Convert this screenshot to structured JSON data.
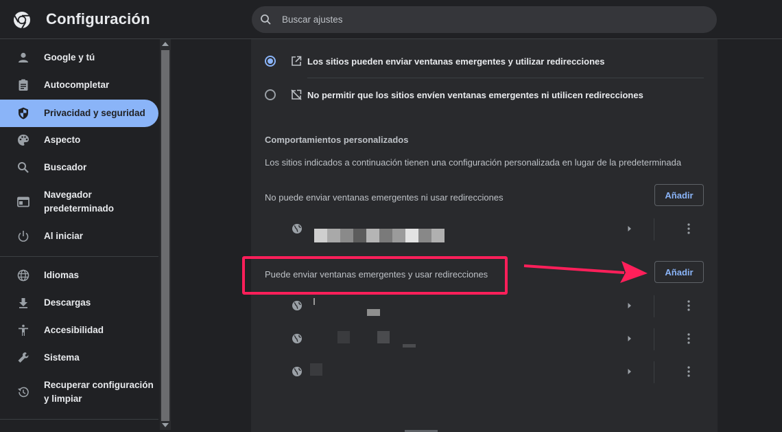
{
  "header": {
    "title": "Configuración",
    "search_placeholder": "Buscar ajustes"
  },
  "sidebar": {
    "items": [
      {
        "label": "Google y tú",
        "icon": "person-icon"
      },
      {
        "label": "Autocompletar",
        "icon": "clipboard-icon"
      },
      {
        "label": "Privacidad y seguridad",
        "icon": "shield-icon",
        "active": true
      },
      {
        "label": "Aspecto",
        "icon": "palette-icon"
      },
      {
        "label": "Buscador",
        "icon": "search-icon"
      },
      {
        "label": "Navegador predeterminado",
        "icon": "browser-icon"
      },
      {
        "label": "Al iniciar",
        "icon": "power-icon"
      },
      {
        "label": "Idiomas",
        "icon": "globe-icon"
      },
      {
        "label": "Descargas",
        "icon": "download-icon"
      },
      {
        "label": "Accesibilidad",
        "icon": "accessibility-icon"
      },
      {
        "label": "Sistema",
        "icon": "wrench-icon"
      },
      {
        "label": "Recuperar configuración y limpiar",
        "icon": "history-icon"
      }
    ]
  },
  "popups": {
    "option_allow": "Los sitios pueden enviar ventanas emergentes y utilizar redirecciones",
    "option_block": "No permitir que los sitios envíen ventanas emergentes ni utilicen redirecciones",
    "selected": "allow",
    "custom_title": "Comportamientos personalizados",
    "custom_desc": "Los sitios indicados a continuación tienen una configuración personalizada en lugar de la predeterminada",
    "block_list_label": "No puede enviar ventanas emergentes ni usar redirecciones",
    "allow_list_label": "Puede enviar ventanas emergentes y usar redirecciones",
    "add_label": "Añadir"
  },
  "colors": {
    "accent": "#8ab4f8",
    "highlight": "#ff1f5a"
  }
}
